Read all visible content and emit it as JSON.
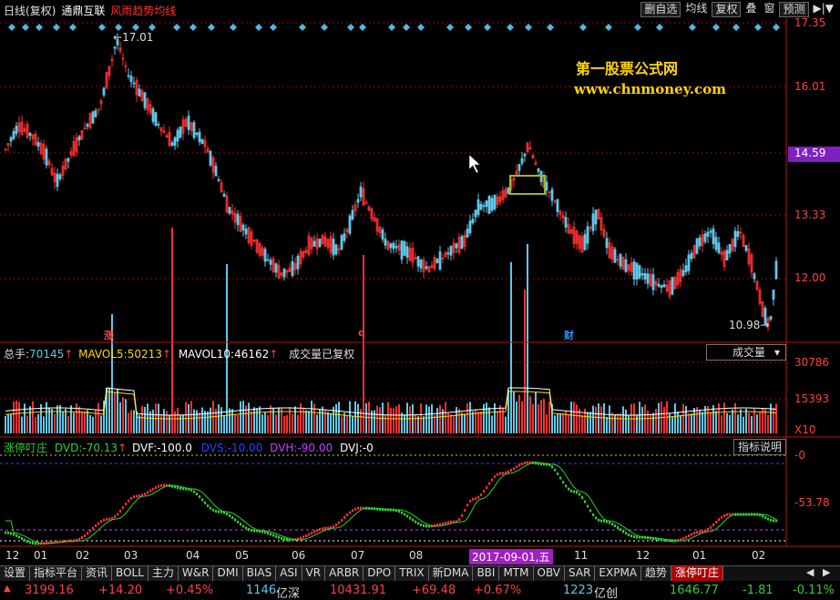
{
  "header": {
    "period_label": "日线(复权)",
    "stock_name": "通鼎互联",
    "indicator_name": "风雨趋势均线"
  },
  "toolbar": [
    {
      "id": "tb-select",
      "label": "删自选"
    },
    {
      "id": "tb-ma",
      "label": "均线"
    },
    {
      "id": "tb-fuquan",
      "label": "复权"
    },
    {
      "id": "tb-overlay",
      "label": "叠"
    },
    {
      "id": "tb-window",
      "label": "窗"
    },
    {
      "id": "tb-forecast",
      "label": "预测"
    },
    {
      "id": "tb-arrow",
      "label": "▶|▼"
    }
  ],
  "watermark": {
    "line1": "第一股票公式网",
    "line2": "www.chnmoney.com"
  },
  "price_axis": {
    "labels": [
      "17.35",
      "16.01",
      "14.59",
      "13.33",
      "12.00"
    ],
    "current": "14.59"
  },
  "price_markers": {
    "high": "17.01",
    "low": "10.98"
  },
  "event_markers": [
    {
      "label": "涨",
      "color": "#ff4040"
    },
    {
      "label": "q",
      "color": "#ff4040"
    },
    {
      "label": "财",
      "color": "#3090ff"
    }
  ],
  "volume_legend": {
    "total_label": "总手:",
    "total_value": "70145",
    "mavol5_label": "MAVOL5:",
    "mavol5_value": "50213",
    "mavol10_label": "MAVOL10:",
    "mavol10_value": "46162",
    "note": "成交量已复权"
  },
  "volume_axis": {
    "labels": [
      "30786",
      "15393"
    ],
    "unit": "X10"
  },
  "volume_dropdown": "成交量",
  "indicator_legend": {
    "name": "涨停叮庄",
    "dvd_label": "DVD:",
    "dvd_value": "-70.13",
    "dvf_label": "DVF:",
    "dvf_value": "-100.0",
    "dvs_label": "DVS:",
    "dvs_value": "-10.00",
    "dvh_label": "DVH:",
    "dvh_value": "-90.00",
    "dvj_label": "DVJ:",
    "dvj_value": "-0"
  },
  "indicator_button": "指标说明",
  "indicator_axis": {
    "labels": [
      "-0",
      "-53.78"
    ]
  },
  "x_axis": {
    "labels": [
      "12",
      "01",
      "02",
      "03",
      "04",
      "05",
      "06",
      "07",
      "08",
      "11",
      "12",
      "01",
      "02"
    ],
    "highlight": "2017-09-01,五"
  },
  "tabs": [
    "设置",
    "指标平台",
    "资讯",
    "BOLL",
    "主力",
    "W&R",
    "DMI",
    "BIAS",
    "ASI",
    "VR",
    "ARBR",
    "DPO",
    "TRIX",
    "新DMA",
    "BBI",
    "MTM",
    "OBV",
    "SAR",
    "EXPMA",
    "趋势",
    "涨停叮庄"
  ],
  "active_tab": "涨停叮庄",
  "status": {
    "sh_index": "3199.16",
    "sh_change": "+14.20",
    "sh_pct": "+0.45%",
    "sz_amount": "1146",
    "sz_unit": "亿深",
    "sz_index": "10431.91",
    "sz_change": "+69.48",
    "sz_pct": "+0.67%",
    "cy_amount": "1223",
    "cy_unit": "亿创",
    "cy_index": "1646.77",
    "cy_change": "-1.81",
    "cy_pct": "-0.11%"
  },
  "colors": {
    "up": "#ff3030",
    "down": "#60c8e8",
    "ma": "#ffffff",
    "grid": "#8a1010",
    "axis": "#b01818",
    "purple": "#8020c0",
    "green": "#30d030"
  }
}
